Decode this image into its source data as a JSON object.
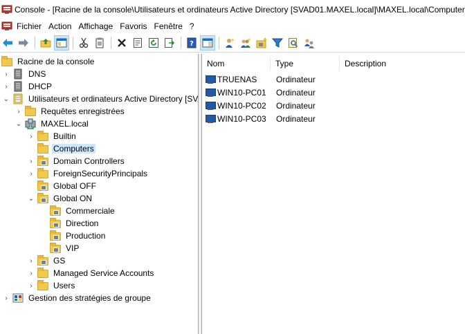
{
  "window": {
    "title": "Console - [Racine de la console\\Utilisateurs et ordinateurs Active Directory [SVAD01.MAXEL.local]\\MAXEL.local\\Computers]"
  },
  "menu": [
    "Fichier",
    "Action",
    "Affichage",
    "Favoris",
    "Fenêtre",
    "?"
  ],
  "toolbar": {
    "icons": [
      "back-arrow-icon",
      "forward-arrow-icon",
      "up-folder-icon",
      "show-hide-console-tree-icon",
      "cut-icon",
      "copy-icon",
      "delete-icon",
      "properties-icon",
      "refresh-icon",
      "export-list-icon",
      "help-icon",
      "show-hide-action-pane-icon",
      "new-user-icon",
      "new-group-icon",
      "new-ou-icon",
      "filter-icon",
      "find-icon",
      "add-to-group-icon"
    ],
    "colors": {
      "blue_arrow": "#1a8fd8",
      "selected_bg": "#cce4f7"
    }
  },
  "tree": {
    "root": "Racine de la console",
    "dns": "DNS",
    "dhcp": "DHCP",
    "aduc": "Utilisateurs et ordinateurs Active Directory [SVAD01.MAXEL.local]",
    "saved_queries": "Requêtes enregistrées",
    "domain": "MAXEL.local",
    "builtin": "Builtin",
    "computers": "Computers",
    "domain_controllers": "Domain Controllers",
    "foreign": "ForeignSecurityPrincipals",
    "global_off": "Global OFF",
    "global_on": "Global ON",
    "commerciale": "Commerciale",
    "direction": "Direction",
    "production": "Production",
    "vip": "VIP",
    "gs": "GS",
    "msa": "Managed Service Accounts",
    "users": "Users",
    "gpo": "Gestion des stratégies de groupe"
  },
  "list": {
    "columns": [
      "Nom",
      "Type",
      "Description"
    ],
    "rows": [
      {
        "name": "TRUENAS",
        "type": "Ordinateur",
        "description": ""
      },
      {
        "name": "WIN10-PC01",
        "type": "Ordinateur",
        "description": ""
      },
      {
        "name": "WIN10-PC02",
        "type": "Ordinateur",
        "description": ""
      },
      {
        "name": "WIN10-PC03",
        "type": "Ordinateur",
        "description": ""
      }
    ]
  }
}
